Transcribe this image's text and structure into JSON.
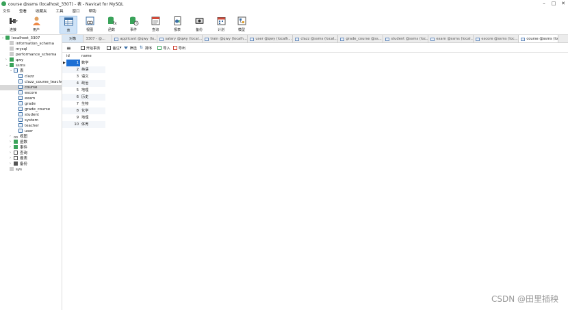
{
  "window": {
    "title": "course @ssms (localhost_3307) - 表 - Navicat for MySQL"
  },
  "menu": [
    "文件",
    "查看",
    "收藏夹",
    "工具",
    "窗口",
    "帮助"
  ],
  "toolbar": {
    "connect": "连接",
    "user": "用户",
    "table": "表",
    "view": "视图",
    "function": "函数",
    "event": "事件",
    "query": "查询",
    "report": "报表",
    "backup": "备份",
    "schedule": "计划",
    "model": "模型"
  },
  "sidebar": {
    "connection": "localhost_3307",
    "databases_top": [
      "information_schema",
      "mysql",
      "performance_schema"
    ],
    "db_qwy": "qwy",
    "db_ssms": "ssms",
    "tables_node": "表",
    "tables": [
      "clazz",
      "clazz_course_teacher",
      "course",
      "escore",
      "exam",
      "grade",
      "grade_course",
      "student",
      "system",
      "teacher",
      "user"
    ],
    "selected_table": "course",
    "nodes_after": [
      "视图",
      "函数",
      "事件",
      "查询",
      "报表",
      "备份"
    ],
    "db_sys": "sys"
  },
  "tabs": {
    "objects": "对象",
    "list": [
      "3307 - @...",
      "applicant @qwy (lo...",
      "salary @qwy (local...",
      "train @qwy (localh...",
      "user @qwy (localh...",
      "clazz @ssms (local...",
      "grade_course @ss...",
      "student @ssms (loc...",
      "exam @ssms (local...",
      "escore @ssms (loc...",
      "course @ssms (lo..."
    ]
  },
  "subtoolbar": {
    "begin_transaction": "开始事务",
    "memo": "备注",
    "filter": "筛选",
    "sort": "排序",
    "import": "导入",
    "export": "导出"
  },
  "grid": {
    "columns": [
      "id",
      "name"
    ],
    "rows": [
      {
        "id": "1",
        "name": "数学"
      },
      {
        "id": "2",
        "name": "英语"
      },
      {
        "id": "3",
        "name": "语文"
      },
      {
        "id": "4",
        "name": "政治"
      },
      {
        "id": "5",
        "name": "地理"
      },
      {
        "id": "6",
        "name": "历史"
      },
      {
        "id": "7",
        "name": "生物"
      },
      {
        "id": "8",
        "name": "化学"
      },
      {
        "id": "9",
        "name": "地理"
      },
      {
        "id": "10",
        "name": "体育"
      }
    ]
  },
  "watermark": "CSDN @田里插秧",
  "colors": {
    "accent": "#1a73e8",
    "selected_cell": "#1c6fd4",
    "tab_active": "#dbe8f5",
    "db_green": "#3aa35a"
  }
}
